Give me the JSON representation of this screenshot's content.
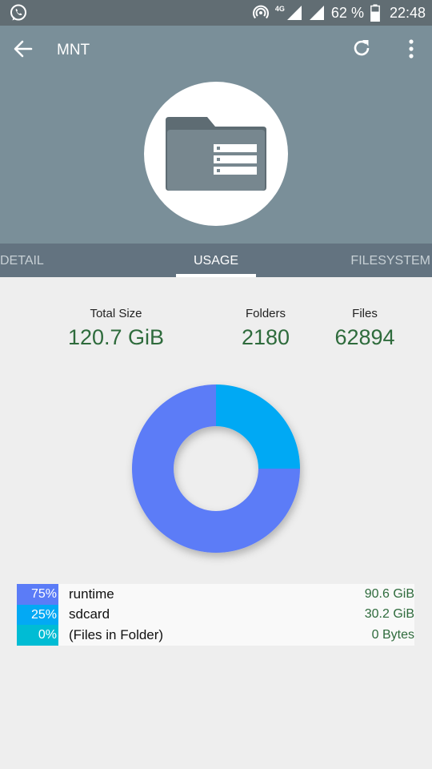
{
  "status": {
    "network": "4G",
    "battery": "62 %",
    "time": "22:48"
  },
  "appbar": {
    "title": "MNT"
  },
  "tabs": [
    "DETAIL",
    "USAGE",
    "FILESYSTEM"
  ],
  "stats": {
    "total_size_label": "Total Size",
    "total_size": "120.7 GiB",
    "folders_label": "Folders",
    "folders": "2180",
    "files_label": "Files",
    "files": "62894"
  },
  "colors": {
    "runtime": "#5b7cf7",
    "sdcard": "#03a9f4",
    "files_in_folder": "#00bcd4"
  },
  "chart_data": {
    "type": "pie",
    "categories": [
      "runtime",
      "sdcard",
      "(Files in Folder)"
    ],
    "values": [
      75,
      25,
      0
    ]
  },
  "legend": [
    {
      "pct": "75%",
      "name": "runtime",
      "size": "90.6 GiB"
    },
    {
      "pct": "25%",
      "name": "sdcard",
      "size": "30.2 GiB"
    },
    {
      "pct": "0%",
      "name": "(Files in Folder)",
      "size": "0 Bytes"
    }
  ]
}
